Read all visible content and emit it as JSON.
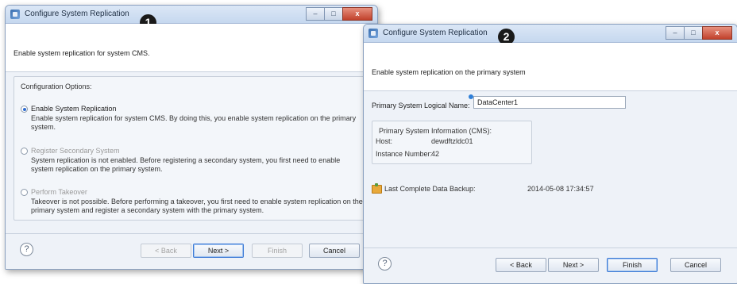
{
  "window1": {
    "title": "Configure System Replication",
    "step": "1",
    "controls": {
      "minimize": "–",
      "maximize": "□",
      "close": "x"
    },
    "header_text": "Enable system replication for system CMS.",
    "group_legend": "Configuration Options:",
    "options": [
      {
        "label": "Enable System Replication",
        "selected": true,
        "enabled": true,
        "description": "Enable system replication for system CMS. By doing this, you enable system replication on the primary system."
      },
      {
        "label": "Register Secondary System",
        "selected": false,
        "enabled": false,
        "description": "System replication is not enabled. Before registering a secondary system, you first need to enable system replication on the primary system."
      },
      {
        "label": "Perform Takeover",
        "selected": false,
        "enabled": false,
        "description": "Takeover is not possible. Before performing a takeover, you first need to enable system replication on the primary system and register a secondary system with the primary system."
      }
    ],
    "help_icon": "?",
    "buttons": {
      "back": "< Back",
      "next": "Next >",
      "finish": "Finish",
      "cancel": "Cancel"
    }
  },
  "window2": {
    "title": "Configure System Replication",
    "step": "2",
    "controls": {
      "minimize": "–",
      "maximize": "□",
      "close": "x"
    },
    "header_text": "Enable system replication on the primary system",
    "logical_name_label": "Primary System Logical Name:",
    "logical_name_value": "DataCenter1",
    "info_legend": "Primary System Information (CMS):",
    "host_label": "Host:",
    "host_value": "dewdftzldc01",
    "instance_label": "Instance Number:",
    "instance_value": "42",
    "backup_label": "Last Complete Data Backup:",
    "backup_value": "2014-05-08 17:34:57",
    "help_icon": "?",
    "buttons": {
      "back": "< Back",
      "next": "Next >",
      "finish": "Finish",
      "cancel": "Cancel"
    }
  },
  "colors": {
    "accent": "#2d6bd0",
    "title_bar": "#c6d8ef",
    "close_button": "#c1412c"
  }
}
